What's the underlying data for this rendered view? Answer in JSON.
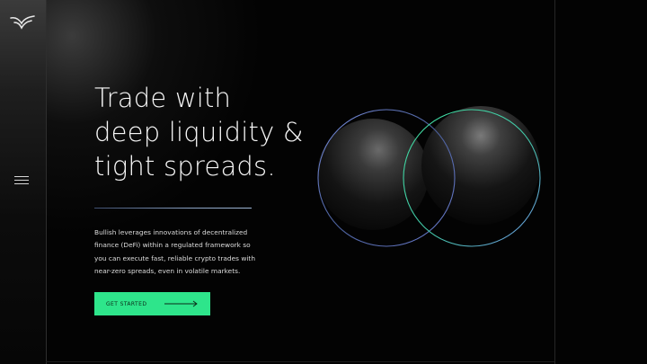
{
  "nav": {
    "logo_icon": "bullish-logo-icon",
    "menu_icon": "hamburger-menu-icon"
  },
  "hero": {
    "headline_lines": [
      "Trade with",
      "deep liquidity &",
      "tight spreads."
    ],
    "body_lines": [
      "Bullish leverages innovations of decentralized",
      "finance (DeFi) within a regulated framework so",
      "you can execute fast, reliable crypto trades with",
      "near-zero spreads, even in volatile markets."
    ],
    "cta_label": "GET STARTED",
    "cta_icon": "arrow-right-icon"
  },
  "colors": {
    "background": "#030303",
    "accent_green": "#2ee58b",
    "ring_green": "#3fe0a0",
    "ring_blue": "#7a8fe0",
    "divider_blue": "#8aa2c4"
  }
}
